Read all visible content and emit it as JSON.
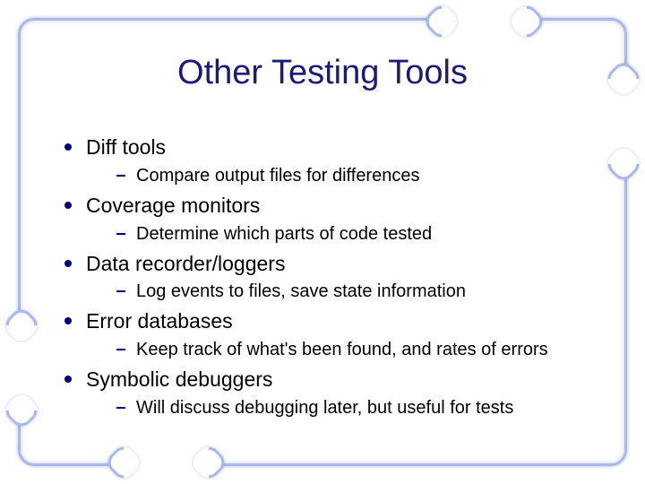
{
  "title": "Other Testing Tools",
  "items": [
    {
      "label": "Diff tools",
      "sub": "Compare output files for differences"
    },
    {
      "label": "Coverage monitors",
      "sub": "Determine which parts of code tested"
    },
    {
      "label": "Data recorder/loggers",
      "sub": "Log events to files, save state information"
    },
    {
      "label": "Error databases",
      "sub": "Keep track of what's been found, and rates of errors"
    },
    {
      "label": "Symbolic debuggers",
      "sub": "Will discuss debugging later, but useful for tests"
    }
  ]
}
